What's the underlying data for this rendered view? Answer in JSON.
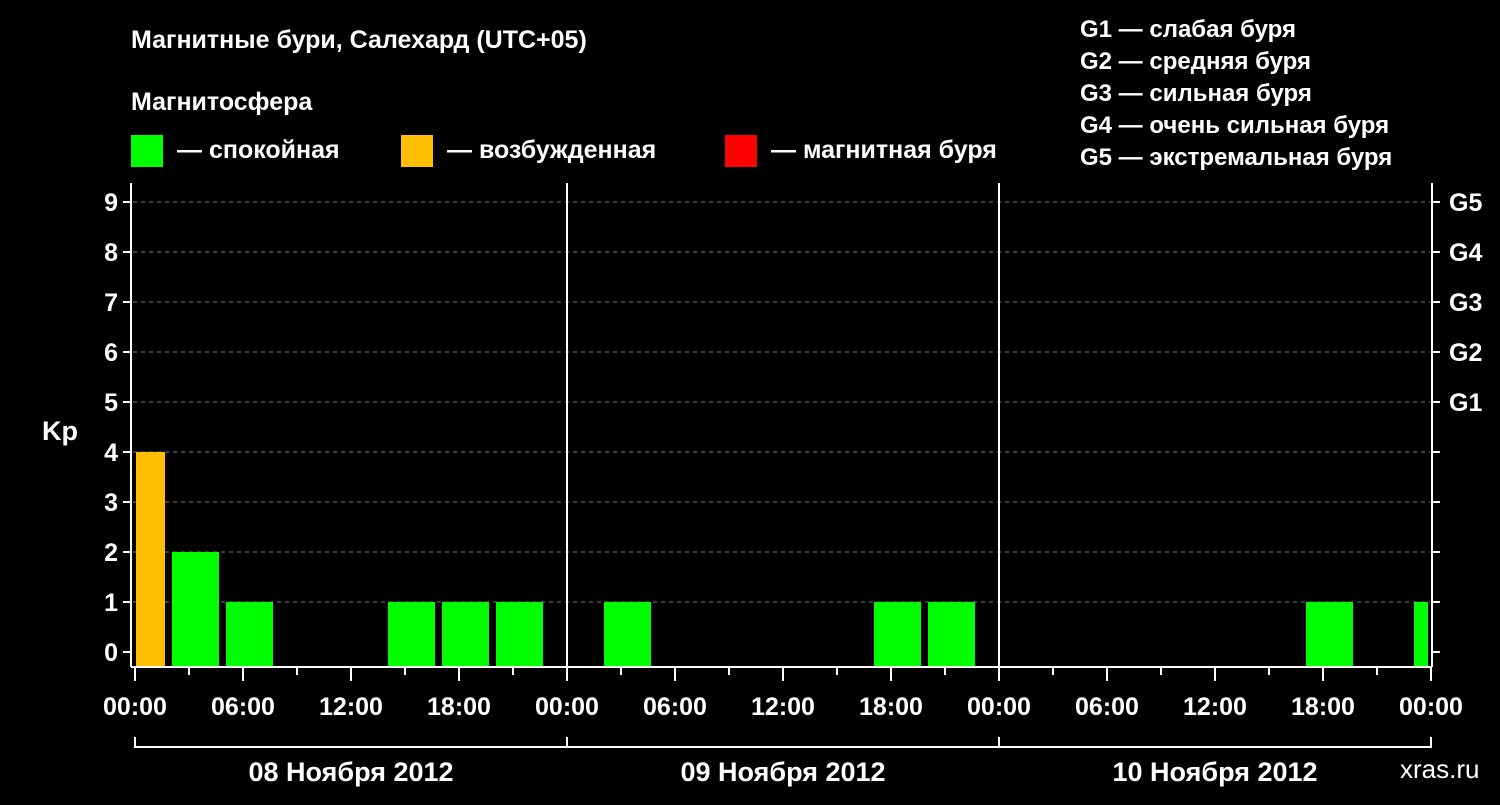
{
  "title": "Магнитные бури, Салехард (UTC+05)",
  "subtitle": "Магнитосфера",
  "legend_status": [
    {
      "color": "#00ff00",
      "label": "— спокойная"
    },
    {
      "color": "#ffbf00",
      "label": "— возбужденная"
    },
    {
      "color": "#ff0000",
      "label": "— магнитная буря"
    }
  ],
  "legend_g": [
    "G1 — слабая буря",
    "G2 — средняя буря",
    "G3 — сильная буря",
    "G4 — очень сильная буря",
    "G5 — экстремальная буря"
  ],
  "watermark": "xras.ru",
  "chart_data": {
    "type": "bar",
    "ylabel": "Kp",
    "ylim": [
      0,
      9
    ],
    "yticks": [
      0,
      1,
      2,
      3,
      4,
      5,
      6,
      7,
      8,
      9
    ],
    "right_axis_labels": [
      {
        "kp": 5,
        "label": "G1"
      },
      {
        "kp": 6,
        "label": "G2"
      },
      {
        "kp": 7,
        "label": "G3"
      },
      {
        "kp": 8,
        "label": "G4"
      },
      {
        "kp": 9,
        "label": "G5"
      }
    ],
    "x_range_hours": [
      0,
      72
    ],
    "x_tick_labels": [
      {
        "hour": 0,
        "label": "00:00"
      },
      {
        "hour": 6,
        "label": "06:00"
      },
      {
        "hour": 12,
        "label": "12:00"
      },
      {
        "hour": 18,
        "label": "18:00"
      },
      {
        "hour": 24,
        "label": "00:00"
      },
      {
        "hour": 30,
        "label": "06:00"
      },
      {
        "hour": 36,
        "label": "12:00"
      },
      {
        "hour": 42,
        "label": "18:00"
      },
      {
        "hour": 48,
        "label": "00:00"
      },
      {
        "hour": 54,
        "label": "06:00"
      },
      {
        "hour": 60,
        "label": "12:00"
      },
      {
        "hour": 66,
        "label": "18:00"
      },
      {
        "hour": 72,
        "label": "00:00"
      }
    ],
    "days": [
      "08 Ноября 2012",
      "09 Ноября 2012",
      "10 Ноября 2012"
    ],
    "grid": "dashed horizontal",
    "bars": [
      {
        "start": 0,
        "end": 2,
        "kp": 4,
        "status": "excited"
      },
      {
        "start": 2,
        "end": 5,
        "kp": 2,
        "status": "quiet"
      },
      {
        "start": 5,
        "end": 8,
        "kp": 1,
        "status": "quiet"
      },
      {
        "start": 14,
        "end": 17,
        "kp": 1,
        "status": "quiet"
      },
      {
        "start": 17,
        "end": 20,
        "kp": 1,
        "status": "quiet"
      },
      {
        "start": 20,
        "end": 23,
        "kp": 1,
        "status": "quiet"
      },
      {
        "start": 26,
        "end": 29,
        "kp": 1,
        "status": "quiet"
      },
      {
        "start": 41,
        "end": 44,
        "kp": 1,
        "status": "quiet"
      },
      {
        "start": 44,
        "end": 47,
        "kp": 1,
        "status": "quiet"
      },
      {
        "start": 65,
        "end": 68,
        "kp": 1,
        "status": "quiet"
      },
      {
        "start": 71,
        "end": 72,
        "kp": 1,
        "status": "quiet"
      }
    ],
    "colors": {
      "quiet": "#00ff00",
      "excited": "#ffbf00",
      "storm": "#ff0000"
    }
  }
}
